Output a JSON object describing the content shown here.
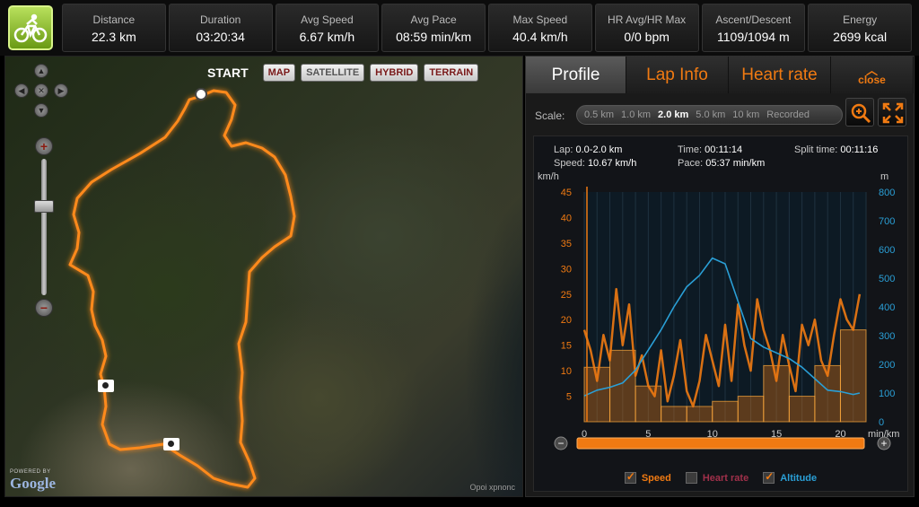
{
  "stats": [
    {
      "label": "Distance",
      "value": "22.3 km"
    },
    {
      "label": "Duration",
      "value": "03:20:34"
    },
    {
      "label": "Avg Speed",
      "value": "6.67 km/h"
    },
    {
      "label": "Avg Pace",
      "value": "08:59 min/km"
    },
    {
      "label": "Max Speed",
      "value": "40.4 km/h"
    },
    {
      "label": "HR Avg/HR Max",
      "value": "0/0 bpm"
    },
    {
      "label": "Ascent/Descent",
      "value": "1109/1094 m"
    },
    {
      "label": "Energy",
      "value": "2699 kcal"
    }
  ],
  "app_icon": "cyclist-icon",
  "map": {
    "start_label": "START",
    "types": [
      "MAP",
      "SATELLITE",
      "HYBRID",
      "TERRAIN"
    ],
    "powered_by": "POWERED BY",
    "google": "Google",
    "copyright": "Opoi xpnonc"
  },
  "tabs": [
    "Profile",
    "Lap Info",
    "Heart rate"
  ],
  "close_label": "close",
  "scale": {
    "label": "Scale:",
    "options": [
      "0.5 km",
      "1.0 km",
      "2.0 km",
      "5.0 km",
      "10 km",
      "Recorded"
    ],
    "selected": "2.0 km"
  },
  "lap": {
    "lap_label": "Lap:",
    "lap_value": "0.0-2.0 km",
    "speed_label": "Speed:",
    "speed_value": "10.67 km/h",
    "time_label": "Time:",
    "time_value": "00:11:14",
    "pace_label": "Pace:",
    "pace_value": "05:37 min/km",
    "split_label": "Split time:",
    "split_value": "00:11:16"
  },
  "legend": [
    {
      "label": "Speed",
      "checked": true,
      "color": "#f07a12"
    },
    {
      "label": "Heart rate",
      "checked": false,
      "color": "#a0304a"
    },
    {
      "label": "Altitude",
      "checked": true,
      "color": "#2a9fd6"
    }
  ],
  "colors": {
    "accent": "#f07a12",
    "altitude": "#2a9fd6",
    "heart_rate": "#a0304a"
  },
  "chart_data": {
    "type": "line",
    "xlabel": "min/km",
    "ylabel_left": "km/h",
    "ylabel_right": "m",
    "xlim": [
      0,
      22
    ],
    "x_ticks": [
      0,
      5,
      10,
      15,
      20
    ],
    "ylim_left": [
      0,
      45
    ],
    "y_ticks_left": [
      5,
      10,
      15,
      20,
      25,
      30,
      35,
      40,
      45
    ],
    "ylim_right": [
      0,
      800
    ],
    "y_ticks_right": [
      0,
      100,
      200,
      300,
      400,
      500,
      600,
      700,
      800
    ],
    "series": [
      {
        "name": "Speed",
        "axis": "left",
        "x": [
          0,
          0.5,
          1,
          1.5,
          2,
          2.5,
          3,
          3.5,
          4,
          4.5,
          5,
          5.5,
          6,
          6.5,
          7,
          7.5,
          8,
          8.5,
          9,
          9.5,
          10,
          10.5,
          11,
          11.5,
          12,
          12.5,
          13,
          13.5,
          14,
          14.5,
          15,
          15.5,
          16,
          16.5,
          17,
          17.5,
          18,
          18.5,
          19,
          19.5,
          20,
          20.5,
          21,
          21.5
        ],
        "values": [
          18,
          14,
          8,
          17,
          12,
          26,
          15,
          23,
          9,
          13,
          7,
          5,
          14,
          4,
          9,
          16,
          6,
          3,
          8,
          17,
          12,
          7,
          19,
          8,
          23,
          15,
          10,
          24,
          18,
          14,
          8,
          17,
          11,
          6,
          19,
          15,
          20,
          12,
          9,
          17,
          24,
          20,
          18,
          25
        ]
      },
      {
        "name": "Altitude",
        "axis": "right",
        "x": [
          0,
          1,
          2,
          3,
          4,
          5,
          6,
          7,
          8,
          9,
          10,
          11,
          12,
          13,
          14,
          15,
          16,
          17,
          18,
          19,
          20,
          21,
          21.5
        ],
        "values": [
          90,
          110,
          120,
          135,
          180,
          250,
          320,
          400,
          470,
          510,
          570,
          550,
          420,
          290,
          260,
          240,
          220,
          190,
          150,
          110,
          105,
          95,
          100
        ]
      },
      {
        "name": "Lap average",
        "axis": "left",
        "x": [
          0,
          2,
          4,
          6,
          8,
          10,
          12,
          14,
          16,
          18,
          20
        ],
        "values": [
          10.67,
          14,
          7,
          3,
          3,
          4,
          5,
          11,
          5,
          11,
          18
        ]
      }
    ]
  }
}
